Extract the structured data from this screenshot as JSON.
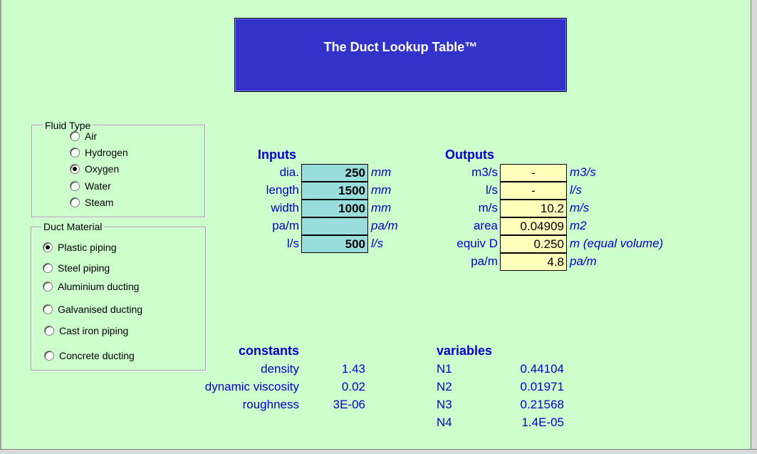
{
  "title": "The Duct Lookup Table™",
  "fluid_type": {
    "legend": "Fluid  Type",
    "options": [
      "Air",
      "Hydrogen",
      "Oxygen",
      "Water",
      "Steam"
    ],
    "selected": "Oxygen"
  },
  "duct_material": {
    "legend": "Duct Material",
    "options": [
      "Plastic  piping",
      "Steel  piping",
      "Aluminium  ducting",
      "Galvanised  ducting",
      "Cast iron  piping",
      "Concrete  ducting"
    ],
    "selected": "Plastic  piping"
  },
  "inputs": {
    "header": "Inputs",
    "rows": [
      {
        "label": "dia.",
        "value": "250",
        "unit": "mm"
      },
      {
        "label": "length",
        "value": "1500",
        "unit": "mm"
      },
      {
        "label": "width",
        "value": "1000",
        "unit": "mm"
      },
      {
        "label": "pa/m",
        "value": "",
        "unit": "pa/m"
      },
      {
        "label": "l/s",
        "value": "500",
        "unit": "l/s"
      }
    ]
  },
  "outputs": {
    "header": "Outputs",
    "rows": [
      {
        "label": "m3/s",
        "value": "-",
        "unit": "m3/s"
      },
      {
        "label": "l/s",
        "value": "-",
        "unit": "l/s"
      },
      {
        "label": "m/s",
        "value": "10.2",
        "unit": "m/s"
      },
      {
        "label": "area",
        "value": "0.04909",
        "unit": "m2"
      },
      {
        "label": "equiv D",
        "value": "0.250",
        "unit": "m (equal volume)"
      },
      {
        "label": "pa/m",
        "value": "4.8",
        "unit": "pa/m"
      }
    ]
  },
  "constants": {
    "header": "constants",
    "rows": [
      {
        "label": "density",
        "value": "1.43"
      },
      {
        "label": "dynamic viscosity",
        "value": "0.02"
      },
      {
        "label": "roughness",
        "value": "3E-06"
      }
    ]
  },
  "variables": {
    "header": "variables",
    "rows": [
      {
        "label": "N1",
        "value": "0.44104"
      },
      {
        "label": "N2",
        "value": "0.01971"
      },
      {
        "label": "N3",
        "value": "0.21568"
      },
      {
        "label": "N4",
        "value": "1.4E-05"
      }
    ]
  },
  "colors": {
    "background": "#ccffcc",
    "title_bg": "#3333cc",
    "label_text": "#0000cc",
    "input_cell": "#99dddd",
    "output_cell": "#ffffbb"
  }
}
